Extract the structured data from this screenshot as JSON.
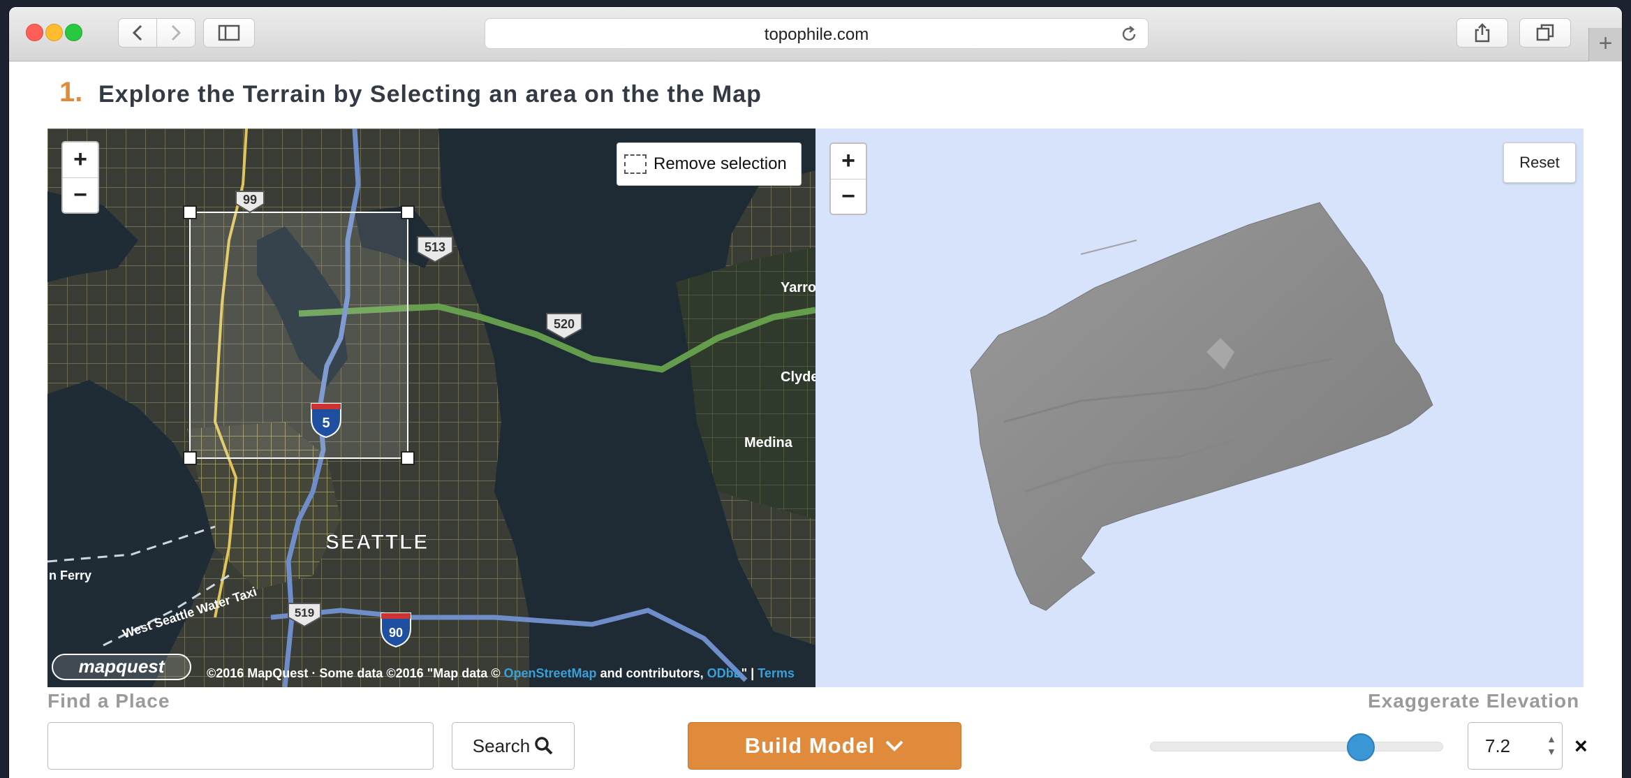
{
  "browser": {
    "url": "topophile.com",
    "colors": {
      "close": "#ff5f57",
      "minimize": "#febc2e",
      "maximize": "#28c840"
    }
  },
  "page": {
    "step_number": "1.",
    "step_title": "Explore the Terrain by Selecting an area on the the Map"
  },
  "map": {
    "zoom_in": "+",
    "zoom_out": "−",
    "remove_selection_label": "Remove selection",
    "labels": {
      "seattle": "SEATTLE",
      "medina": "Medina",
      "clyde": "Clyde",
      "yarrow": "Yarro",
      "ferry": "n Ferry",
      "west_seattle": "West Seattle Water Taxi"
    },
    "shields": {
      "sr99": "99",
      "sr513": "513",
      "sr520": "520",
      "i5": "5",
      "sr519": "519",
      "i90": "90"
    },
    "attribution": {
      "mapquest": "©2016 MapQuest",
      "sep": "·",
      "some_data": "Some data ©2016 \"Map data ©",
      "osm": "OpenStreetMap",
      "contrib": "and contributors,",
      "odbl": "ODbL",
      "pipe": "\" |",
      "terms": "Terms"
    },
    "logo": "mapquest"
  },
  "viewer": {
    "zoom_in": "+",
    "zoom_out": "−",
    "reset_label": "Reset"
  },
  "controls": {
    "find_label": "Find a Place",
    "find_value": "",
    "search_label": "Search",
    "build_label": "Build Model",
    "exaggerate_label": "Exaggerate Elevation",
    "elevation_value": "7.2",
    "elevation_fraction": 0.72,
    "clear_label": "×"
  },
  "theme": {
    "accent": "#e08a3c",
    "slider": "#3b96d6",
    "viewer_bg": "#d6e3fb"
  }
}
